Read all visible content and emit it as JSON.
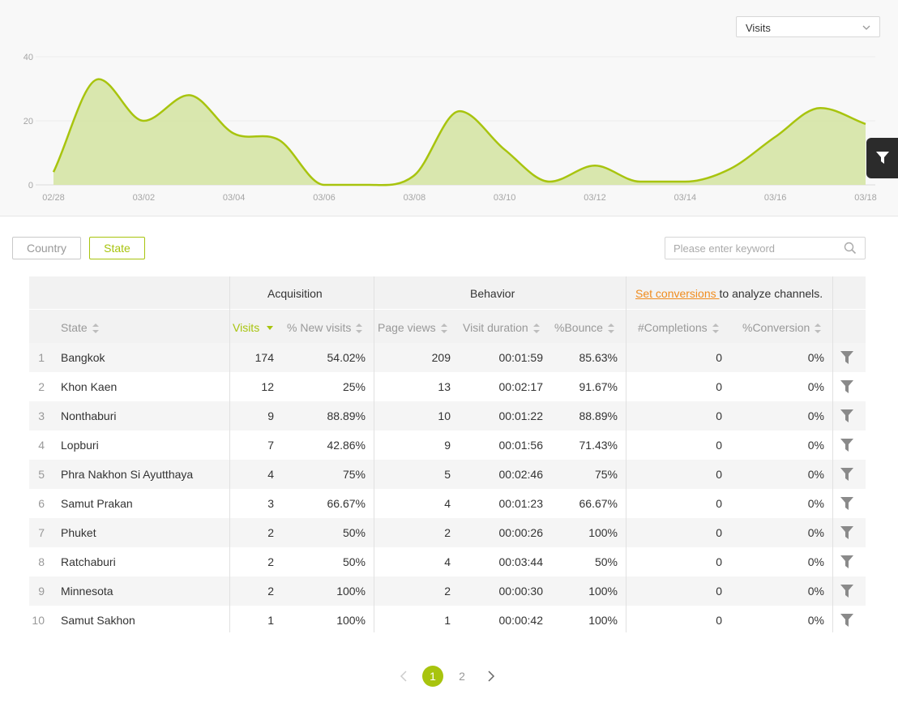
{
  "metric_select": {
    "value": "Visits"
  },
  "chart_data": {
    "type": "area",
    "x": [
      "02/28",
      "03/01",
      "03/02",
      "03/03",
      "03/04",
      "03/05",
      "03/06",
      "03/07",
      "03/08",
      "03/09",
      "03/10",
      "03/11",
      "03/12",
      "03/13",
      "03/14",
      "03/15",
      "03/16",
      "03/17",
      "03/18"
    ],
    "x_tick_labels": [
      "02/28",
      "03/02",
      "03/04",
      "03/06",
      "03/08",
      "03/10",
      "03/12",
      "03/14",
      "03/16",
      "03/18"
    ],
    "values": [
      4,
      33,
      20,
      28,
      16,
      14,
      0,
      0,
      3,
      23,
      11,
      1,
      6,
      1,
      1,
      5,
      15,
      24,
      19
    ],
    "y_ticks": [
      0,
      20,
      40
    ],
    "ylim": [
      0,
      40
    ],
    "grid": true,
    "colors": {
      "line": "#a8c40e",
      "fill": "#d5e4a5"
    }
  },
  "toolbar": {
    "country_label": "Country",
    "state_label": "State",
    "active": "State",
    "search_placeholder": "Please enter keyword"
  },
  "table": {
    "groups": {
      "acquisition": "Acquisition",
      "behavior": "Behavior",
      "conversion_link": "Set conversions ",
      "conversion_text": "to analyze channels."
    },
    "columns": {
      "state": "State",
      "visits": "Visits",
      "new_visits": "% New visits",
      "page_views": "Page views",
      "duration": "Visit duration",
      "bounce": "%Bounce",
      "completions": "#Completions",
      "conversion": "%Conversion"
    },
    "rows": [
      {
        "idx": "1",
        "state": "Bangkok",
        "visits": "174",
        "new": "54.02%",
        "pv": "209",
        "dur": "00:01:59",
        "bounce": "85.63%",
        "comp": "0",
        "conv": "0%"
      },
      {
        "idx": "2",
        "state": "Khon Kaen",
        "visits": "12",
        "new": "25%",
        "pv": "13",
        "dur": "00:02:17",
        "bounce": "91.67%",
        "comp": "0",
        "conv": "0%"
      },
      {
        "idx": "3",
        "state": "Nonthaburi",
        "visits": "9",
        "new": "88.89%",
        "pv": "10",
        "dur": "00:01:22",
        "bounce": "88.89%",
        "comp": "0",
        "conv": "0%"
      },
      {
        "idx": "4",
        "state": "Lopburi",
        "visits": "7",
        "new": "42.86%",
        "pv": "9",
        "dur": "00:01:56",
        "bounce": "71.43%",
        "comp": "0",
        "conv": "0%"
      },
      {
        "idx": "5",
        "state": "Phra Nakhon Si Ayutthaya",
        "visits": "4",
        "new": "75%",
        "pv": "5",
        "dur": "00:02:46",
        "bounce": "75%",
        "comp": "0",
        "conv": "0%"
      },
      {
        "idx": "6",
        "state": "Samut Prakan",
        "visits": "3",
        "new": "66.67%",
        "pv": "4",
        "dur": "00:01:23",
        "bounce": "66.67%",
        "comp": "0",
        "conv": "0%"
      },
      {
        "idx": "7",
        "state": "Phuket",
        "visits": "2",
        "new": "50%",
        "pv": "2",
        "dur": "00:00:26",
        "bounce": "100%",
        "comp": "0",
        "conv": "0%"
      },
      {
        "idx": "8",
        "state": "Ratchaburi",
        "visits": "2",
        "new": "50%",
        "pv": "4",
        "dur": "00:03:44",
        "bounce": "50%",
        "comp": "0",
        "conv": "0%"
      },
      {
        "idx": "9",
        "state": "Minnesota",
        "visits": "2",
        "new": "100%",
        "pv": "2",
        "dur": "00:00:30",
        "bounce": "100%",
        "comp": "0",
        "conv": "0%"
      },
      {
        "idx": "10",
        "state": "Samut Sakhon",
        "visits": "1",
        "new": "100%",
        "pv": "1",
        "dur": "00:00:42",
        "bounce": "100%",
        "comp": "0",
        "conv": "0%"
      }
    ]
  },
  "pagination": {
    "pages": [
      "1",
      "2"
    ],
    "current": "1"
  },
  "icons": {
    "filter": "funnel-icon",
    "search": "search-icon",
    "prev": "chevron-left-icon",
    "next": "chevron-right-icon",
    "dropdown": "chevron-down-icon"
  },
  "colors": {
    "accent": "#a8c40e",
    "link": "#f08c1e",
    "side_panel": "#2b2b2b"
  }
}
